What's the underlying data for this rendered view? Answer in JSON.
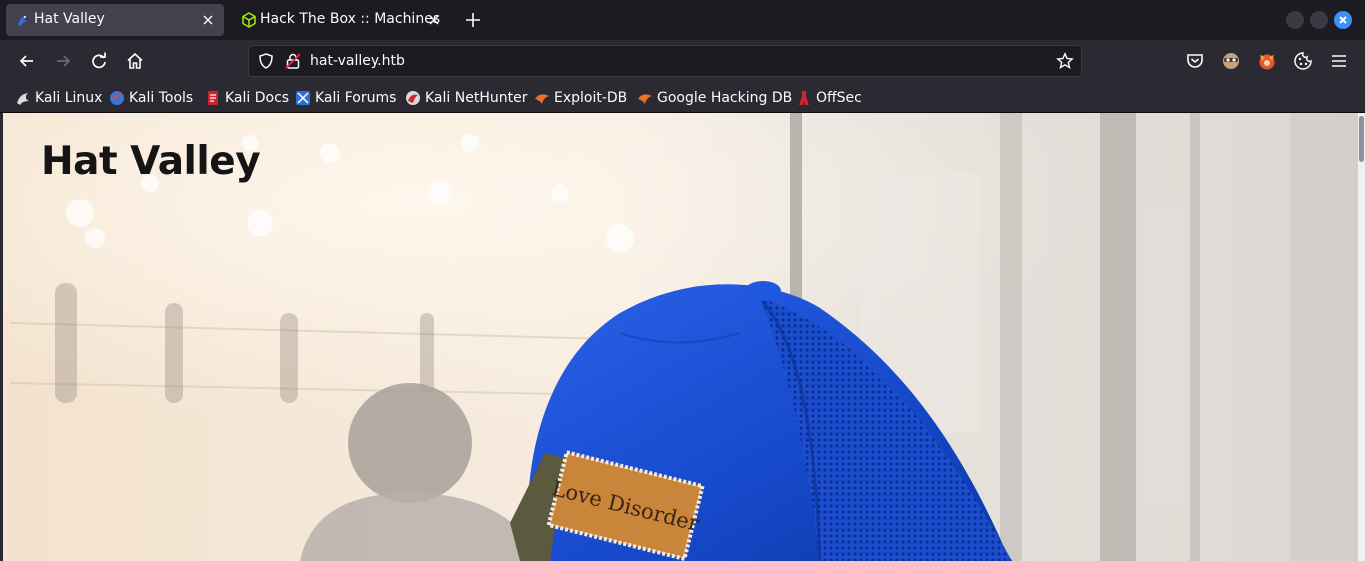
{
  "tabs": [
    {
      "title": "Hat Valley",
      "active": true,
      "favicon": "kali-dragon-icon"
    },
    {
      "title": "Hack The Box :: Machines",
      "active": false,
      "favicon": "htb-cube-icon"
    }
  ],
  "navbar": {
    "url": "hat-valley.htb"
  },
  "bookmarks": [
    {
      "label": "Kali Linux",
      "icon": "kali-dragon-icon"
    },
    {
      "label": "Kali Tools",
      "icon": "kali-tools-icon"
    },
    {
      "label": "Kali Docs",
      "icon": "kali-docs-icon"
    },
    {
      "label": "Kali Forums",
      "icon": "kali-forums-icon"
    },
    {
      "label": "Kali NetHunter",
      "icon": "nethunter-icon"
    },
    {
      "label": "Exploit-DB",
      "icon": "exploit-db-icon"
    },
    {
      "label": "Google Hacking DB",
      "icon": "ghdb-icon"
    },
    {
      "label": "OffSec",
      "icon": "offsec-icon"
    }
  ],
  "page": {
    "site_title": "Hat Valley",
    "hat_patch_text": "Love Disorder"
  },
  "colors": {
    "tabstrip_bg": "#1c1b22",
    "toolbar_bg": "#2b2a33",
    "active_tab_bg": "#42414d",
    "hat_blue": "#1a4fd6",
    "patch_orange": "#c9853a"
  }
}
